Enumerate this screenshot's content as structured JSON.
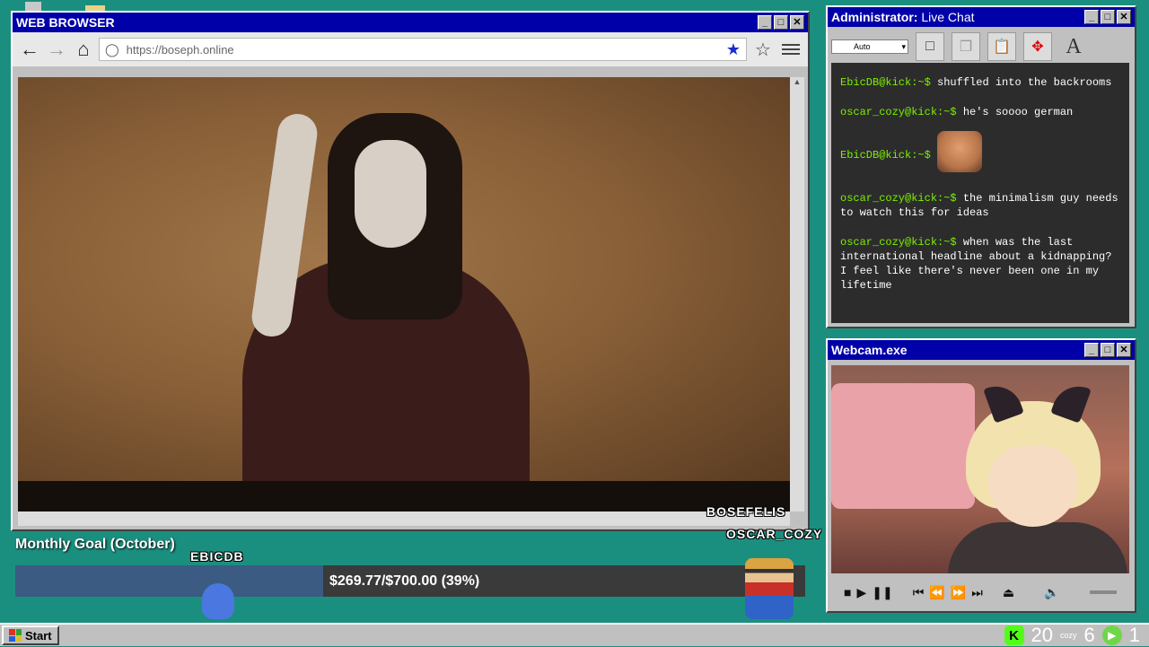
{
  "browser": {
    "title": "WEB BROWSER",
    "url": "https://boseph.online",
    "controls": {
      "minimize": "_",
      "maximize": "□",
      "close": "✕"
    }
  },
  "chat": {
    "title": "Administrator:",
    "subtitle": "Live Chat",
    "select_value": "Auto",
    "messages": [
      {
        "user": "EbicDB@kick:~$",
        "text": "shuffled into the backrooms"
      },
      {
        "user": "oscar_cozy@kick:~$",
        "text": "he's soooo german"
      },
      {
        "user": "EbicDB@kick:~$",
        "text": ""
      },
      {
        "user": "oscar_cozy@kick:~$",
        "text": "the minimalism guy needs to watch this for ideas"
      },
      {
        "user": "oscar_cozy@kick:~$",
        "text": "when was the last international headline about a kidnapping? I feel like there's never been one in my lifetime"
      }
    ]
  },
  "webcam": {
    "title": "Webcam.exe"
  },
  "goal": {
    "title": "Monthly Goal (October)",
    "text": "$269.77/$700.00 (39%)",
    "progress": 0.39
  },
  "overlay": {
    "tag_ebicdb": "EBICDB",
    "tag_bosefelis": "BOSEFELIS",
    "tag_oscar": "OSCAR_COZY"
  },
  "taskbar": {
    "start": "Start",
    "kick_count": "20",
    "cozy_label": "cozy",
    "cozy_count": "6",
    "other_count": "1"
  },
  "colors": {
    "desktop": "#1b8f7f",
    "titlebar": "#0000a8",
    "chat_user": "#7cf000",
    "goal_fill": "#3b5b82",
    "kick": "#53fc18"
  }
}
